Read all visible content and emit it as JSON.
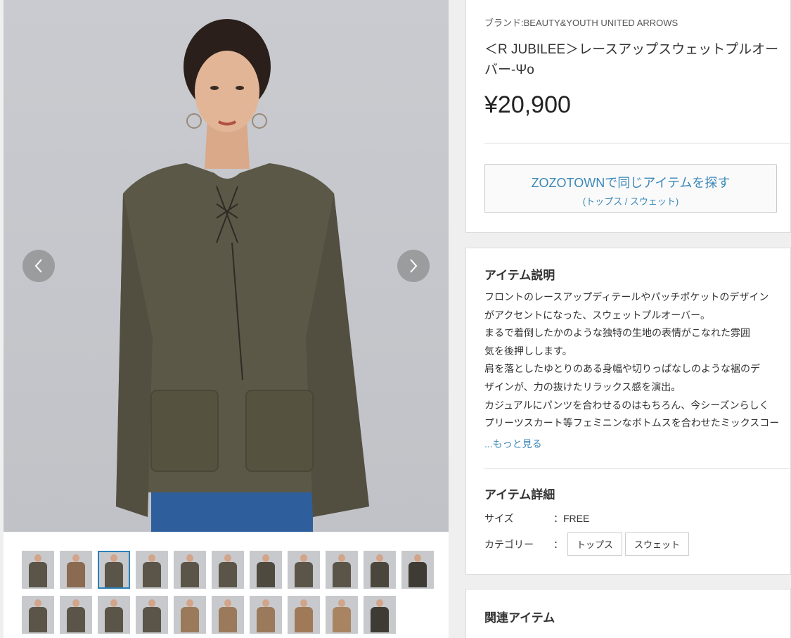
{
  "product": {
    "brand": "ブランド:BEAUTY&YOUTH UNITED ARROWS",
    "title": "＜R JUBILEE＞レースアップスウェットプルオーバー-Ψo",
    "price": "¥20,900"
  },
  "zozo_button": {
    "main": "ZOZOTOWNで同じアイテムを探す",
    "sub": "(トップス / スウェット)"
  },
  "description": {
    "heading": "アイテム説明",
    "lines": [
      "フロントのレースアップディテールやパッチポケットのデザイン",
      "がアクセントになった、スウェットプルオーバー。",
      "まるで着倒したかのような独特の生地の表情がこなれた雰囲",
      "気を後押しします。",
      "肩を落としたゆとりのある身幅や切りっぱなしのような裾のデ",
      "ザインが、力の抜けたリラックス感を演出。",
      "カジュアルにパンツを合わせるのはもちろん、今シーズンらしく",
      "プリーツスカート等フェミニンなボトムスを合わせたミックスコー"
    ],
    "more": "...もっと見る"
  },
  "details": {
    "heading": "アイテム詳細",
    "size_label": "サイズ",
    "size_value": "：FREE",
    "category_label": "カテゴリー",
    "category_sep": "：",
    "categories": [
      "トップス",
      "スウェット"
    ]
  },
  "related": {
    "heading": "関連アイテム"
  },
  "gallery": {
    "prev_icon": "chevron-left-icon",
    "next_icon": "chevron-right-icon",
    "thumb_colors_row1": [
      "#5a5548",
      "#8a6a50",
      "#5a5548",
      "#5a5548",
      "#5a5548",
      "#5a5548",
      "#4e4a40",
      "#5a5548",
      "#5a5548",
      "#4a463c",
      "#3e3b34"
    ],
    "thumb_colors_row2": [
      "#5a5548",
      "#5a5548",
      "#5a5548",
      "#5a5548",
      "#9a7a5a",
      "#9a7a5a",
      "#9a7a5a",
      "#a07a58",
      "#a88462",
      "#3e3b34"
    ]
  }
}
